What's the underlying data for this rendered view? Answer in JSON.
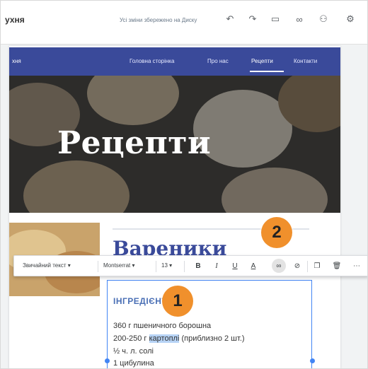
{
  "topbar": {
    "site_name": "ухня",
    "save_status": "Усі зміни збережено на Диску",
    "icons": [
      "undo-icon",
      "redo-icon",
      "preview-icon",
      "link-icon",
      "add-person-icon",
      "settings-icon"
    ]
  },
  "nav": {
    "home": "хня",
    "links": [
      "Головна сторінка",
      "Про нас",
      "Рецепти",
      "Контакти"
    ],
    "active": "Рецепти"
  },
  "hero": {
    "title": "Рецепти"
  },
  "section": {
    "title": "Вареники"
  },
  "toolbar": {
    "style": "Звичайний текст",
    "font": "Montserrat",
    "size": "13",
    "icons": [
      "dropdown-arrow-icon",
      "bold-icon",
      "italic-icon",
      "underline-icon",
      "text-color-icon",
      "link-icon",
      "clear-format-icon",
      "copy-icon",
      "delete-icon",
      "more-icon"
    ]
  },
  "textbox": {
    "heading": "ІНГРЕДІЄНТИ",
    "lines": [
      {
        "pre": "360 г пшеничного борошна",
        "hl": "",
        "post": ""
      },
      {
        "pre": "200-250 г ",
        "hl": "картоплі",
        "post": " (приблизно 2 шт.)"
      },
      {
        "pre": "½ ч. л. солі",
        "hl": "",
        "post": ""
      },
      {
        "pre": "1 цибулина",
        "hl": "",
        "post": ""
      }
    ]
  },
  "callouts": [
    "1",
    "2"
  ],
  "colors": {
    "nav": "#3a4a9a",
    "accent": "#4285f4",
    "callout": "#f0902c",
    "heading": "#4a6fb5"
  }
}
